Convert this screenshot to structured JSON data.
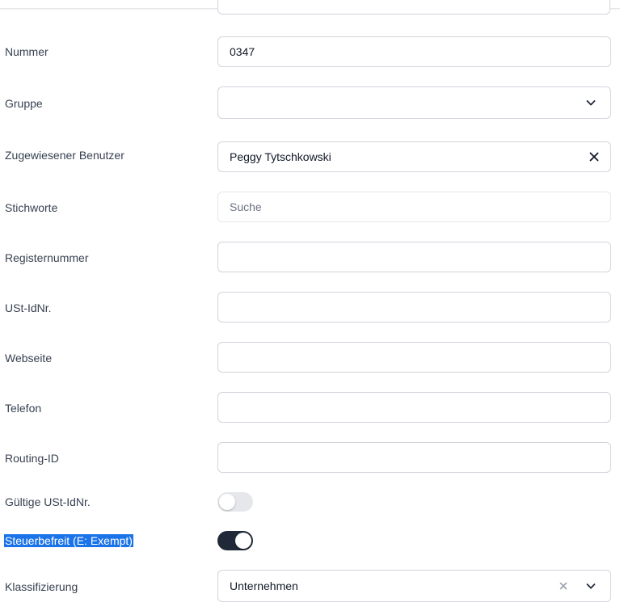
{
  "form": {
    "nummer": {
      "label": "Nummer",
      "value": "0347"
    },
    "gruppe": {
      "label": "Gruppe",
      "value": ""
    },
    "zugewiesener_benutzer": {
      "label": "Zugewiesener Benutzer",
      "value": "Peggy Tytschkowski"
    },
    "stichworte": {
      "label": "Stichworte",
      "placeholder": "Suche"
    },
    "registernummer": {
      "label": "Registernummer",
      "value": ""
    },
    "ust_idnr": {
      "label": "USt-IdNr.",
      "value": ""
    },
    "webseite": {
      "label": "Webseite",
      "value": ""
    },
    "telefon": {
      "label": "Telefon",
      "value": ""
    },
    "routing_id": {
      "label": "Routing-ID",
      "value": ""
    },
    "gueltige_ust_idnr": {
      "label": "Gültige USt-IdNr.",
      "enabled": false
    },
    "steuerbefreit": {
      "label": "Steuerbefreit (E: Exempt)",
      "enabled": true
    },
    "klassifizierung": {
      "label": "Klassifizierung",
      "value": "Unternehmen"
    }
  },
  "icons": {
    "dropdown": "chevron-down-icon",
    "clear": "close-icon"
  },
  "colors": {
    "toggle_on": "#1f2937",
    "toggle_off": "#e5e7eb",
    "selection_highlight": "#1a73e8",
    "border": "#d1d5db"
  }
}
